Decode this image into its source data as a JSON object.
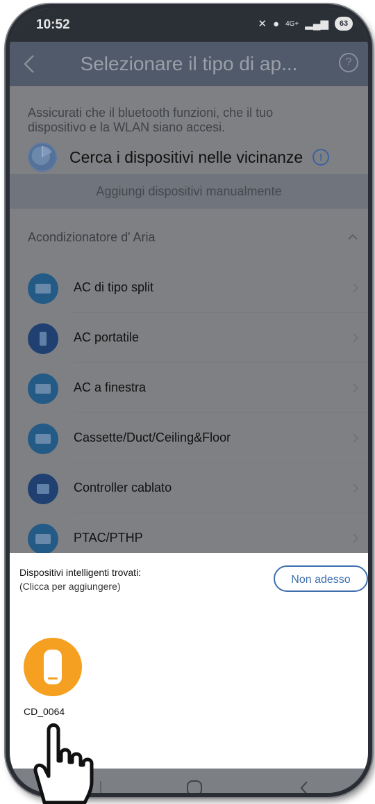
{
  "status_bar": {
    "time": "10:52",
    "network": "4G+",
    "battery": "63"
  },
  "header": {
    "title": "Selezionare il tipo di ap...",
    "help_glyph": "?"
  },
  "intro": {
    "text": "Assicurati che il bluetooth funzioni, che il tuo dispositivo e la WLAN siano accesi.",
    "scan_label": "Cerca i dispositivi nelle vicinanze",
    "info_glyph": "!"
  },
  "manual_add_label": "Aggiungi dispositivi manualmente",
  "category": {
    "label": "Acondizionatore d' Aria"
  },
  "devices": [
    {
      "label": "AC di tipo split"
    },
    {
      "label": "AC portatile"
    },
    {
      "label": "AC a finestra"
    },
    {
      "label": "Cassette/Duct/Ceiling&Floor"
    },
    {
      "label": "Controller cablato"
    },
    {
      "label": "PTAC/PTHP"
    }
  ],
  "sheet": {
    "title": "Dispositivi intelligenti trovati:",
    "subtitle": "(Clicca per aggiungere)",
    "dismiss_label": "Non adesso",
    "found_device": {
      "label": "CD_0064"
    }
  },
  "colors": {
    "accent_blue": "#3f6fb0",
    "device_orange": "#f5a020",
    "overlay_gray": "#7f8083"
  },
  "icons": [
    "back-arrow-icon",
    "help-icon",
    "radar-scan-icon",
    "info-icon",
    "chevron-up-icon",
    "chevron-right-icon",
    "dehumidifier-icon",
    "hand-pointer-icon"
  ]
}
